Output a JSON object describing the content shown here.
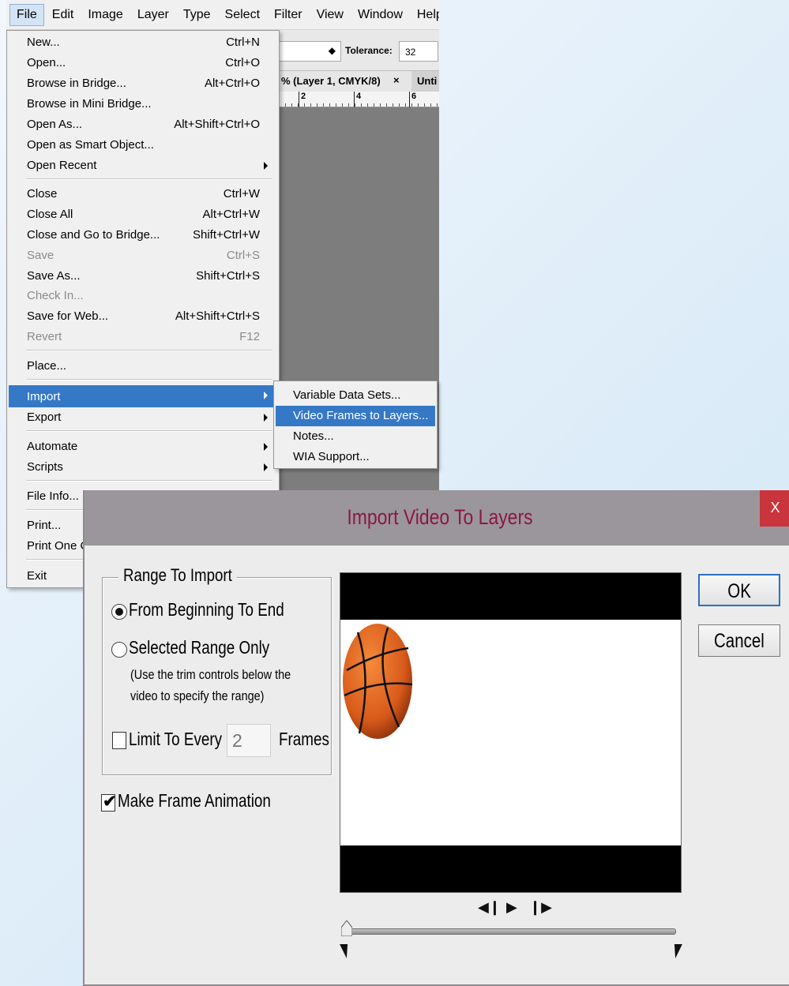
{
  "menubar": {
    "items": [
      "File",
      "Edit",
      "Image",
      "Layer",
      "Type",
      "Select",
      "Filter",
      "View",
      "Window",
      "Help"
    ]
  },
  "options_bar": {
    "tolerance_label": "Tolerance:",
    "tolerance_value": "32"
  },
  "doc_tabs": {
    "active": "% (Layer 1, CMYK/8)",
    "close": "×",
    "next": "Unti"
  },
  "ruler": {
    "ticks": [
      "2",
      "4",
      "6"
    ]
  },
  "file_menu": {
    "items": [
      {
        "label": "New...",
        "shortcut": "Ctrl+N"
      },
      {
        "label": "Open...",
        "shortcut": "Ctrl+O"
      },
      {
        "label": "Browse in Bridge...",
        "shortcut": "Alt+Ctrl+O"
      },
      {
        "label": "Browse in Mini Bridge...",
        "shortcut": ""
      },
      {
        "label": "Open As...",
        "shortcut": "Alt+Shift+Ctrl+O"
      },
      {
        "label": "Open as Smart Object...",
        "shortcut": ""
      },
      {
        "label": "Open Recent",
        "shortcut": ""
      },
      {
        "label": "Close",
        "shortcut": "Ctrl+W"
      },
      {
        "label": "Close All",
        "shortcut": "Alt+Ctrl+W"
      },
      {
        "label": "Close and Go to Bridge...",
        "shortcut": "Shift+Ctrl+W"
      },
      {
        "label": "Save",
        "shortcut": "Ctrl+S"
      },
      {
        "label": "Save As...",
        "shortcut": "Shift+Ctrl+S"
      },
      {
        "label": "Check In...",
        "shortcut": ""
      },
      {
        "label": "Save for Web...",
        "shortcut": "Alt+Shift+Ctrl+S"
      },
      {
        "label": "Revert",
        "shortcut": "F12"
      },
      {
        "label": "Place...",
        "shortcut": ""
      },
      {
        "label": "Import",
        "shortcut": ""
      },
      {
        "label": "Export",
        "shortcut": ""
      },
      {
        "label": "Automate",
        "shortcut": ""
      },
      {
        "label": "Scripts",
        "shortcut": ""
      },
      {
        "label": "File Info...",
        "shortcut": ""
      },
      {
        "label": "Print...",
        "shortcut": ""
      },
      {
        "label": "Print One C",
        "shortcut": ""
      },
      {
        "label": "Exit",
        "shortcut": ""
      }
    ]
  },
  "import_submenu": {
    "items": [
      "Variable Data Sets...",
      "Video Frames to Layers...",
      "Notes...",
      "WIA Support..."
    ]
  },
  "dialog": {
    "title": "Import Video To Layers",
    "close": "X",
    "range_group": "Range To Import",
    "option_all": "From Beginning To End",
    "option_selected": "Selected Range Only",
    "note_line1": "(Use the trim controls below the",
    "note_line2": "video to specify the range)",
    "limit_label": "Limit To Every",
    "limit_value": "2",
    "frames_label": "Frames",
    "make_animation": "Make Frame Animation",
    "ok": "OK",
    "cancel": "Cancel",
    "playback": {
      "prev": "◀❙",
      "play": "▶",
      "next": "❙▶"
    }
  },
  "colors": {
    "menu_highlight": "#3578c6",
    "dialog_title": "#8a1747",
    "close_button": "#c9343d"
  }
}
